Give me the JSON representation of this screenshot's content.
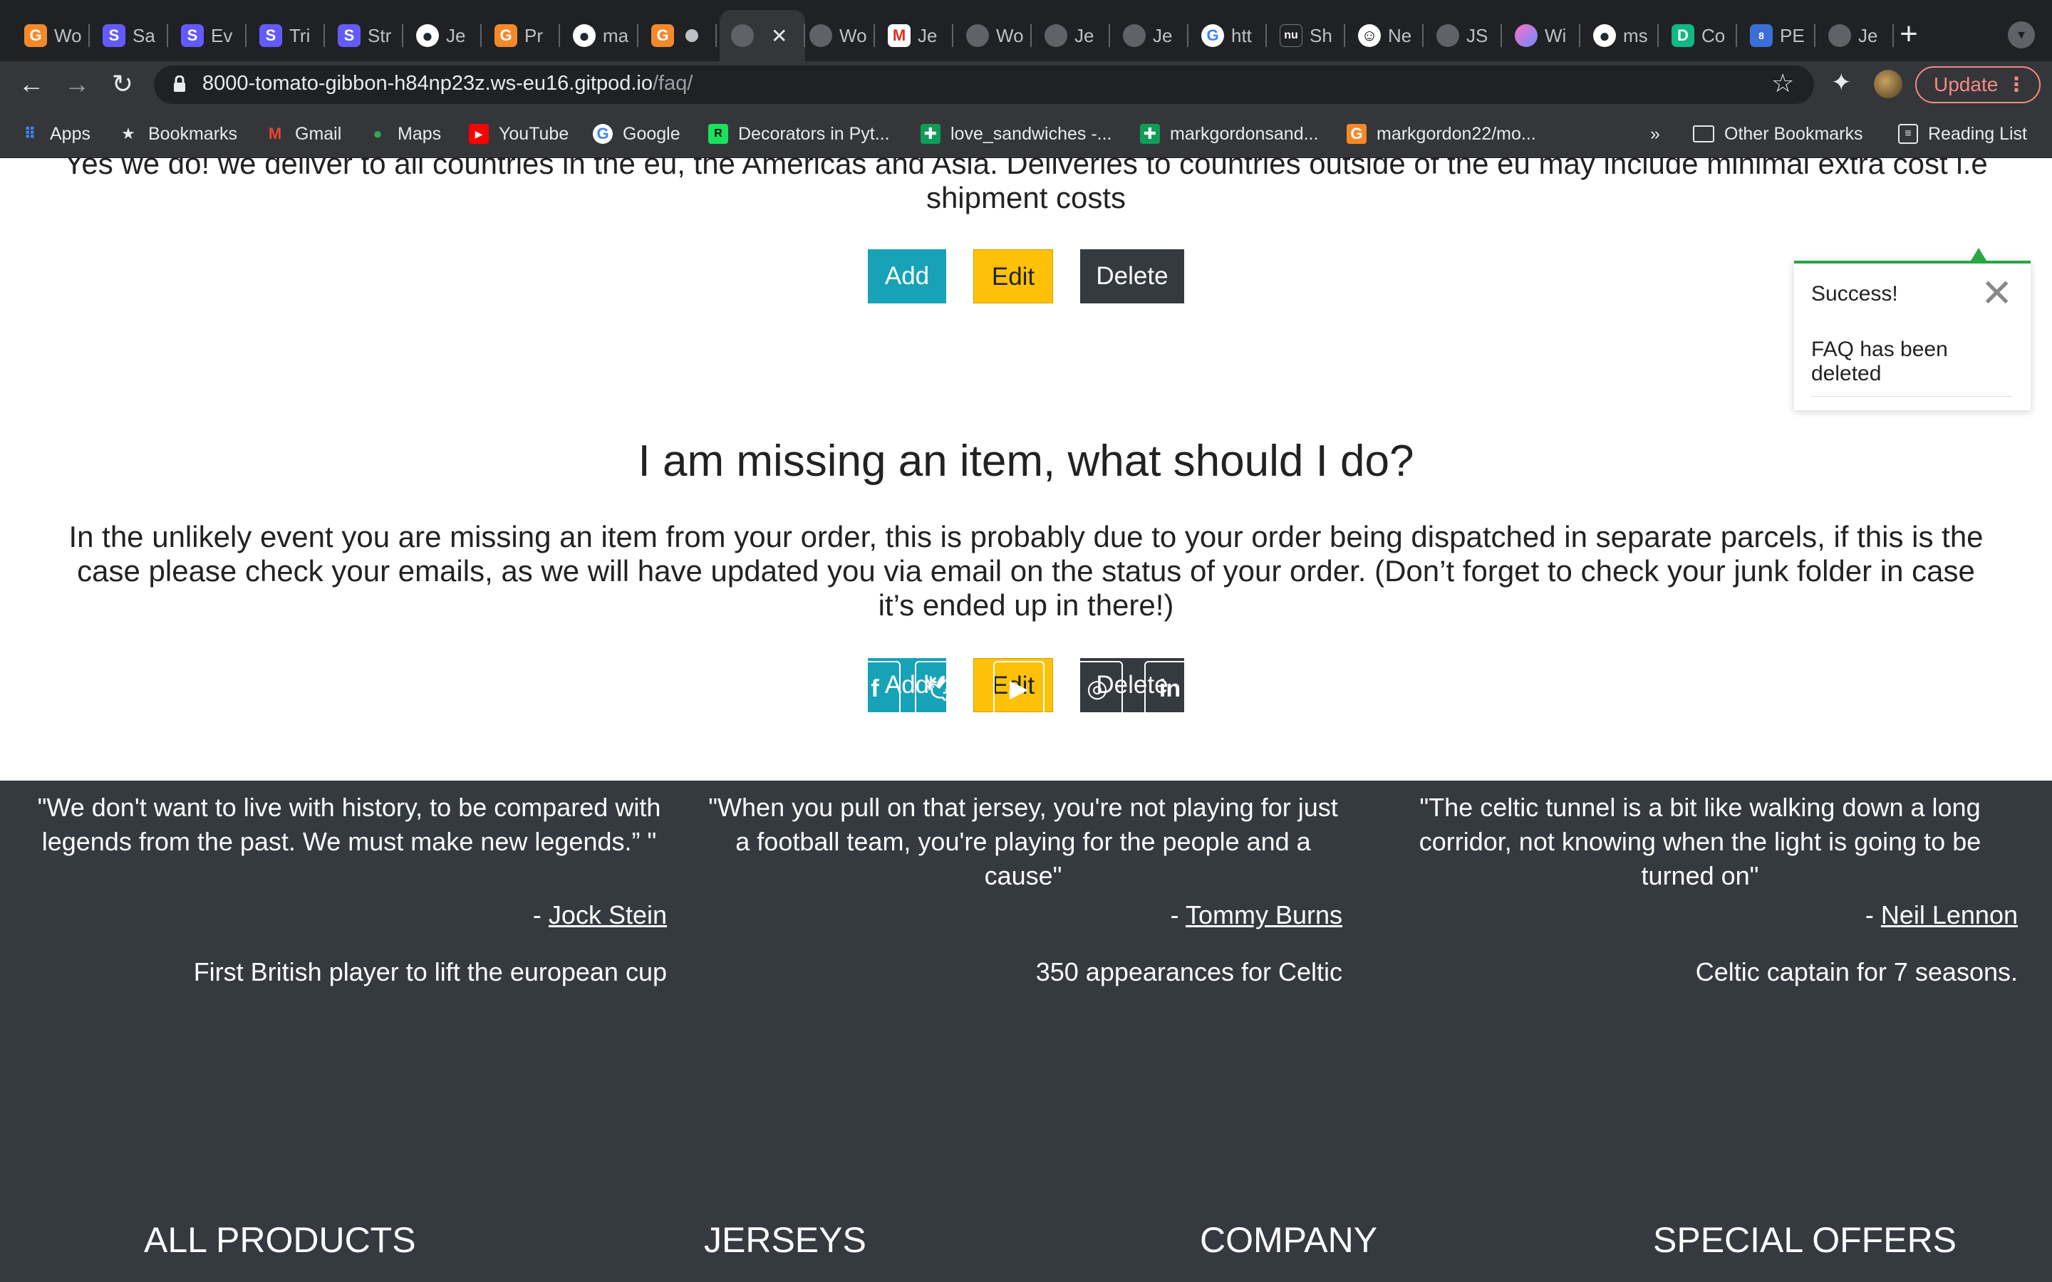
{
  "browser": {
    "tabs": [
      {
        "label": "Wo",
        "icon": "gitpod-icon"
      },
      {
        "label": "Sa",
        "icon": "stripe-icon"
      },
      {
        "label": "Ev",
        "icon": "stripe-icon"
      },
      {
        "label": "Tri",
        "icon": "stripe-icon"
      },
      {
        "label": "Str",
        "icon": "stripe-icon"
      },
      {
        "label": "Je",
        "icon": "github-icon"
      },
      {
        "label": "Pr",
        "icon": "gitpod-icon"
      },
      {
        "label": "ma",
        "icon": "github-icon"
      },
      {
        "label": "",
        "icon": "gitpod-icon"
      },
      {
        "label": "",
        "icon": "globe-icon"
      },
      {
        "label": "Wo",
        "icon": "globe-icon"
      },
      {
        "label": "Je",
        "icon": "gmail-icon"
      },
      {
        "label": "Wo",
        "icon": "globe-icon"
      },
      {
        "label": "Je",
        "icon": "globe-icon"
      },
      {
        "label": "Je",
        "icon": "globe-icon"
      },
      {
        "label": "htt",
        "icon": "google-icon"
      },
      {
        "label": "Sh",
        "icon": "nu-icon"
      },
      {
        "label": "Ne",
        "icon": "smile-icon"
      },
      {
        "label": "JS",
        "icon": "globe-icon"
      },
      {
        "label": "Wi",
        "icon": "colorful-icon"
      },
      {
        "label": "ms",
        "icon": "github-icon"
      },
      {
        "label": "Co",
        "icon": "d-icon"
      },
      {
        "label": "PE",
        "icon": "pep8-icon"
      },
      {
        "label": "Je",
        "icon": "globe-icon"
      }
    ],
    "url_host": "8000-tomato-gibbon-h84np23z.ws-eu16.gitpod.io",
    "url_path": "/faq/",
    "update_label": "Update",
    "bookmarks": [
      {
        "label": "Apps"
      },
      {
        "label": "Bookmarks"
      },
      {
        "label": "Gmail"
      },
      {
        "label": "Maps"
      },
      {
        "label": "YouTube"
      },
      {
        "label": "Google"
      },
      {
        "label": "Decorators in Pyt..."
      },
      {
        "label": "love_sandwiches -..."
      },
      {
        "label": "markgordonsand..."
      },
      {
        "label": "markgordon22/mo..."
      }
    ],
    "more_label": "»",
    "other_bookmarks": "Other Bookmarks",
    "reading_list": "Reading List"
  },
  "faq": {
    "prev_answer_line1": "Yes we do! we deliver to all countries in the eu, the Americas and Asia. Deliveries to countries outside of the eu may include minimal extra cost i.e",
    "prev_answer_line2": "shipment costs",
    "question": "I am missing an item, what should I do?",
    "answer": "In the unlikely event you are missing an item from your order, this is probably due to your order being dispatched in separate parcels, if this is the case please check your emails, as we will have updated you via email on the status of your order. (Don’t forget to check your junk folder in case it’s ended up in there!)",
    "add_label": "Add",
    "edit_label": "Edit",
    "delete_label": "Delete"
  },
  "toast": {
    "title": "Success!",
    "message": "FAQ has been deleted",
    "accent": "#28a745"
  },
  "footer": {
    "social": [
      "facebook-icon",
      "twitter-icon",
      "youtube-icon",
      "instagram-icon",
      "linkedin-icon"
    ],
    "quotes": [
      {
        "text": "\"We don't want to live with history, to be compared with legends from the past. We must make new legends.”  \"",
        "dash": "- ",
        "author": "Jock Stein",
        "fact": "First British player to lift the european cup"
      },
      {
        "text": "\"When you pull on that jersey, you're not playing for just a football team, you're playing for the people and a cause\"",
        "dash": "- ",
        "author": "Tommy Burns",
        "fact": "350 appearances for Celtic"
      },
      {
        "text": "\"The celtic tunnel is a bit like walking down a long corridor, not knowing when the light is going to be turned on\"",
        "dash": "- ",
        "author": "Neil Lennon",
        "fact": "Celtic captain for 7 seasons."
      }
    ],
    "headings": [
      "ALL PRODUCTS",
      "JERSEYS",
      "COMPANY",
      "SPECIAL OFFERS"
    ]
  }
}
